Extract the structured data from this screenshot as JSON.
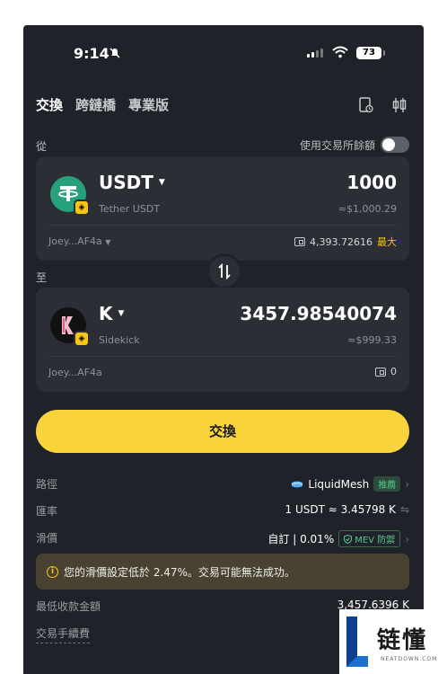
{
  "status": {
    "time": "9:14",
    "battery": "73"
  },
  "tabs": [
    {
      "label": "交換",
      "active": true
    },
    {
      "label": "跨鏈橋",
      "active": false
    },
    {
      "label": "專業版",
      "active": false
    }
  ],
  "from_label": "從",
  "exchange_balance_toggle": {
    "label": "使用交易所餘額",
    "on": false
  },
  "from": {
    "symbol": "USDT",
    "name": "Tether USDT",
    "amount": "1000",
    "fiat": "≈$1,000.29",
    "wallet": "Joey...AF4a",
    "balance": "4,393.72616",
    "max_label": "最大",
    "color": "#26a17b"
  },
  "to_label": "至",
  "to": {
    "symbol": "K",
    "name": "Sidekick",
    "amount": "3457.98540074",
    "fiat": "≈$999.33",
    "wallet": "Joey...AF4a",
    "balance": "0"
  },
  "swap_button": "交換",
  "route": {
    "label": "路徑",
    "provider": "LiquidMesh",
    "tag": "推薦"
  },
  "rate": {
    "label": "匯率",
    "value": "1 USDT ≈ 3.45798 K"
  },
  "slippage": {
    "label": "滑價",
    "value": "自訂 | 0.01%",
    "mev": "MEV 防禦"
  },
  "warning": "您的滑價設定低於 2.47%。交易可能無法成功。",
  "min_received": {
    "label": "最低收款金額",
    "value": "3,457.6396 K"
  },
  "fee_label": "交易手續費",
  "watermark": {
    "brand": "链懂",
    "sub": "NEATDOWN.COM"
  },
  "colors": {
    "accent": "#f8d33a",
    "background": "#1f2228",
    "card": "#2b2e35",
    "positive": "#53c98a"
  }
}
